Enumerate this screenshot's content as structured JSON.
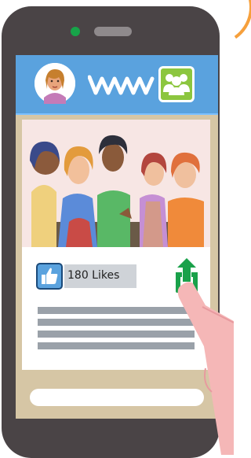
{
  "post": {
    "likes_label": "180 Likes"
  },
  "colors": {
    "topbar": "#5aa2de",
    "share": "#1aa14a",
    "group": "#8cc63f"
  },
  "icons": {
    "avatar": "profile-avatar-icon",
    "logo": "app-logo-icon",
    "group": "group-icon",
    "like": "thumbs-up-icon",
    "share": "share-icon"
  }
}
